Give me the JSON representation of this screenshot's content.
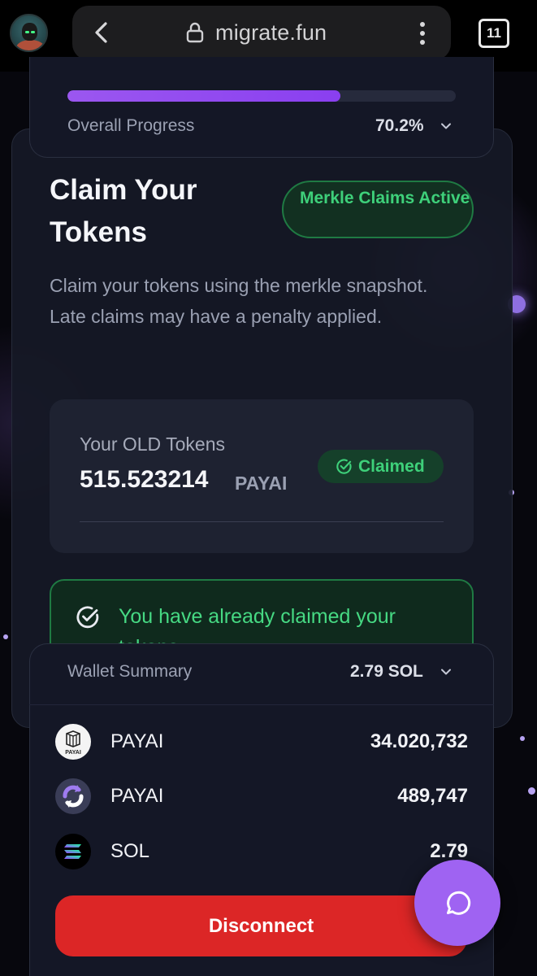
{
  "browser": {
    "url": "migrate.fun",
    "tab_count": "11",
    "icons": [
      "back-icon",
      "lock-icon",
      "menu-icon",
      "tabs-icon"
    ]
  },
  "progress": {
    "label": "Overall Progress",
    "value_text": "70.2%",
    "fraction": 0.702,
    "fill_color": "#9b57f0"
  },
  "claim": {
    "title": "Claim Your Tokens",
    "status_badge": "Merkle Claims Active",
    "description": "Claim your tokens using the merkle snapshot. Late claims may have a penalty applied.",
    "old_tokens_label": "Your OLD Tokens",
    "old_tokens_amount": "515.523214",
    "old_tokens_unit": "PAYAI",
    "claimed_badge": "Claimed",
    "already_claimed_text": "You have already claimed your tokens"
  },
  "wallet": {
    "label": "Wallet Summary",
    "total": "2.79 SOL",
    "assets": [
      {
        "name": "PAYAI",
        "value": "34.020,732",
        "icon": "payai-logo-icon",
        "icon_text": "PAYAI"
      },
      {
        "name": "PAYAI",
        "value": "489,747",
        "icon": "migrate-swap-icon"
      },
      {
        "name": "SOL",
        "value": "2.79",
        "icon": "solana-icon"
      }
    ],
    "disconnect_label": "Disconnect"
  },
  "colors": {
    "accent_purple": "#9f63f2",
    "success_green": "#3ed07a",
    "danger_red": "#dc2626",
    "card_bg": "#161926"
  }
}
